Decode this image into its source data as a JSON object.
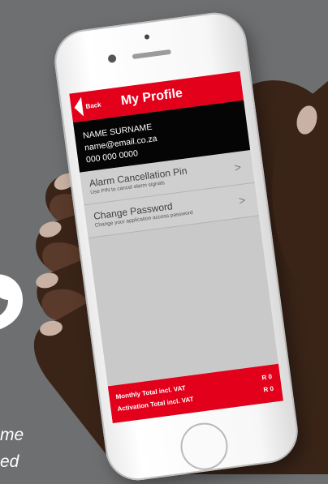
{
  "background": {
    "text_line1": "me",
    "text_line2": "ed",
    "color": "#6e6f71"
  },
  "app": {
    "title": "My Profile",
    "back_label": "Back",
    "accent": "#e3001b",
    "user": {
      "name": "NAME SURNAME",
      "email": "name@email.co.za",
      "phone": "000 000 0000"
    },
    "menu": [
      {
        "title": "Alarm Cancellation Pin",
        "subtitle": "Use PIN to cancel alarm signals",
        "icon": "chevron-right-icon"
      },
      {
        "title": "Change Password",
        "subtitle": "Change your application access password",
        "icon": "chevron-right-icon"
      }
    ],
    "footer": {
      "monthly_label": "Monthly Total incl. VAT",
      "monthly_value": "R 0",
      "activation_label": "Activation Total incl. VAT",
      "activation_value": "R 0"
    }
  }
}
